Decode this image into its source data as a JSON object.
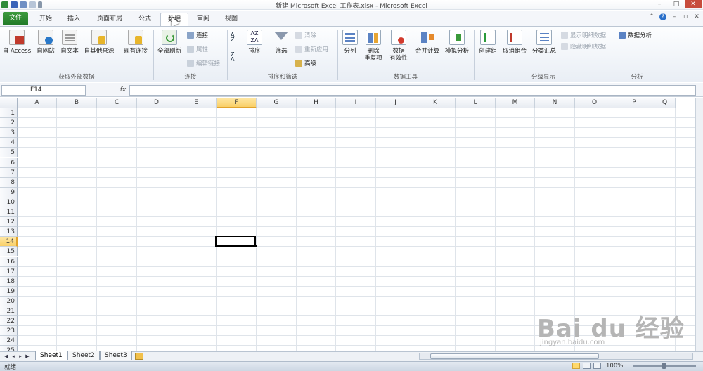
{
  "window": {
    "title": "新建 Microsoft Excel 工作表.xlsx - Microsoft Excel"
  },
  "tabs": {
    "file": "文件",
    "home": "开始",
    "insert": "插入",
    "layout": "页面布局",
    "formulas": "公式",
    "data": "数据",
    "review": "审阅",
    "view": "视图"
  },
  "ribbon": {
    "external": {
      "access": "自 Access",
      "web": "自网站",
      "text": "自文本",
      "other": "自其他来源",
      "existing": "现有连接",
      "label": "获取外部数据"
    },
    "connections": {
      "refresh": "全部刷新",
      "conn": "连接",
      "props": "属性",
      "editlinks": "编辑链接",
      "label": "连接"
    },
    "sort": {
      "az": "A↓Z",
      "sort": "排序",
      "filter": "筛选",
      "clear": "清除",
      "reapply": "重新应用",
      "advanced": "高级",
      "label": "排序和筛选"
    },
    "tools": {
      "split": "分列",
      "dedupe": "删除\n重复项",
      "validate": "数据\n有效性",
      "consolidate": "合并计算",
      "whatif": "模拟分析",
      "label": "数据工具"
    },
    "outline": {
      "group": "创建组",
      "ungroup": "取消组合",
      "subtotal": "分类汇总",
      "show": "显示明细数据",
      "hide": "隐藏明细数据",
      "label": "分级显示"
    },
    "analysis": {
      "da": "数据分析",
      "label": "分析"
    }
  },
  "formula": {
    "namebox": "F14",
    "fx": "fx",
    "value": ""
  },
  "columns": [
    "A",
    "B",
    "C",
    "D",
    "E",
    "F",
    "G",
    "H",
    "I",
    "J",
    "K",
    "L",
    "M",
    "N",
    "O",
    "P",
    "Q"
  ],
  "rows": [
    "1",
    "2",
    "3",
    "4",
    "5",
    "6",
    "7",
    "8",
    "9",
    "10",
    "11",
    "12",
    "13",
    "14",
    "15",
    "16",
    "17",
    "18",
    "19",
    "20",
    "21",
    "22",
    "23",
    "24",
    "25"
  ],
  "selected": {
    "col": "F",
    "row": "14"
  },
  "sheets": [
    "Sheet1",
    "Sheet2",
    "Sheet3"
  ],
  "status": {
    "ready": "就绪",
    "zoom": "100%"
  },
  "watermark": {
    "text": "Bai du 经验",
    "url": "jingyan.baidu.com"
  },
  "colors": {
    "file_tab": "#2e8b34",
    "selected_header": "#f9cf68",
    "accent": "#2a6fc9"
  }
}
